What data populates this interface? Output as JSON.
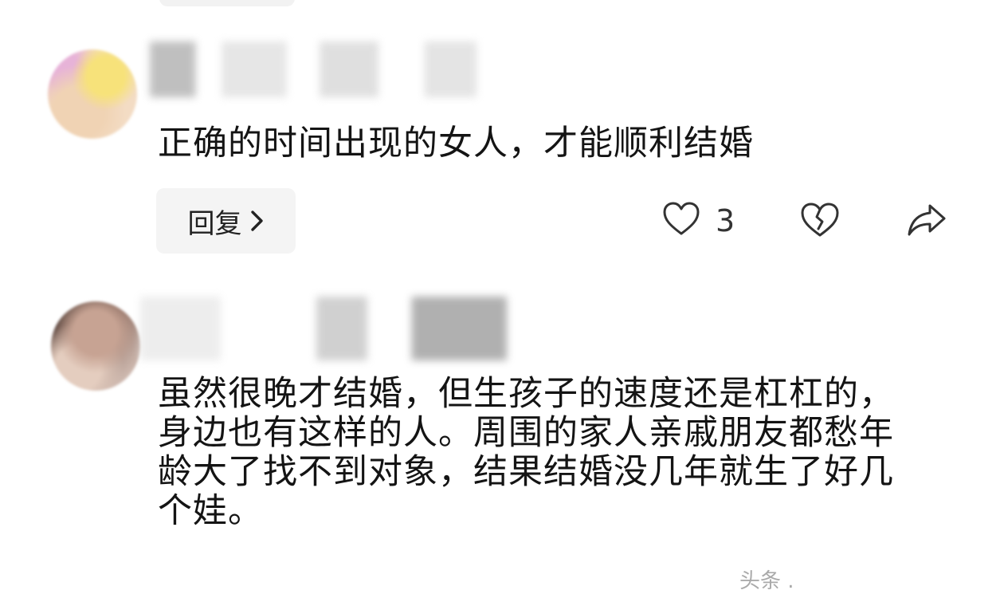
{
  "comments": [
    {
      "username": "",
      "text": "正确的时间出现的女人，才能顺利结婚",
      "reply_label": "回复",
      "likes": "3"
    },
    {
      "username": "",
      "text": "虽然很晚才结婚，但生孩子的速度还是杠杠的，身边也有这样的人。周围的家人亲戚朋友都愁年龄大了找不到对象，结果结婚没几年就生了好几个娃。"
    }
  ],
  "icons": {
    "like": "heart-outline-icon",
    "dislike": "broken-heart-icon",
    "share": "share-arrow-icon",
    "reply_chevron": "chevron-right-icon"
  },
  "watermark": "头条 ."
}
